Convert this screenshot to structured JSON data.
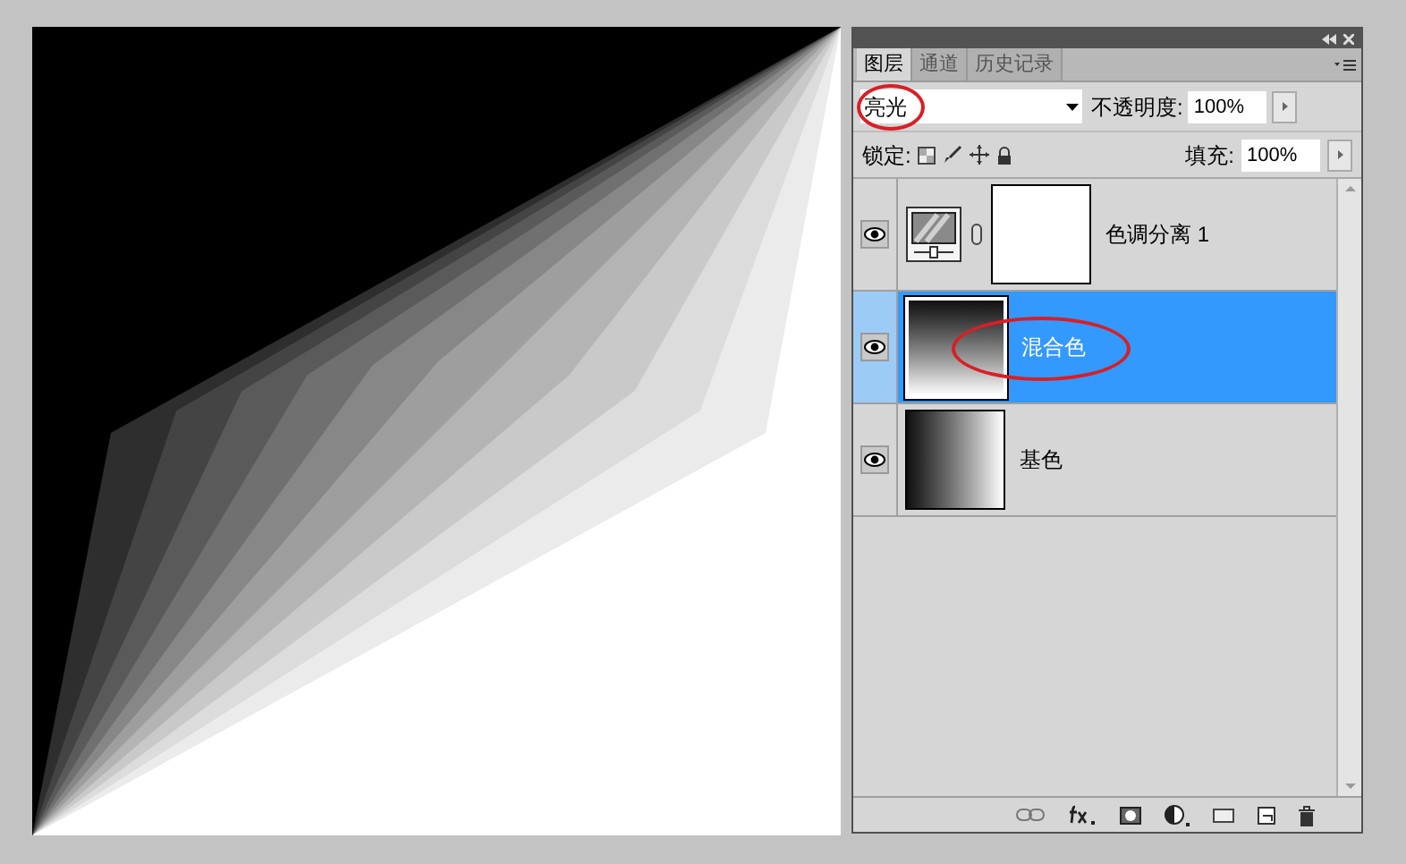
{
  "panel": {
    "tabs": [
      {
        "label": "图层",
        "selected": true
      },
      {
        "label": "通道",
        "selected": false
      },
      {
        "label": "历史记录",
        "selected": false
      }
    ],
    "blend_mode": "亮光",
    "opacity_label": "不透明度:",
    "opacity": "100%",
    "lock_label": "锁定:",
    "fill_label": "填充:",
    "fill": "100%",
    "layers": [
      {
        "name": "色调分离 1",
        "kind": "adjustment",
        "selected": false,
        "visible": true
      },
      {
        "name": "混合色",
        "kind": "vertical-gradient",
        "selected": true,
        "visible": true
      },
      {
        "name": "基色",
        "kind": "horizontal-gradient",
        "selected": false,
        "visible": true
      }
    ]
  }
}
